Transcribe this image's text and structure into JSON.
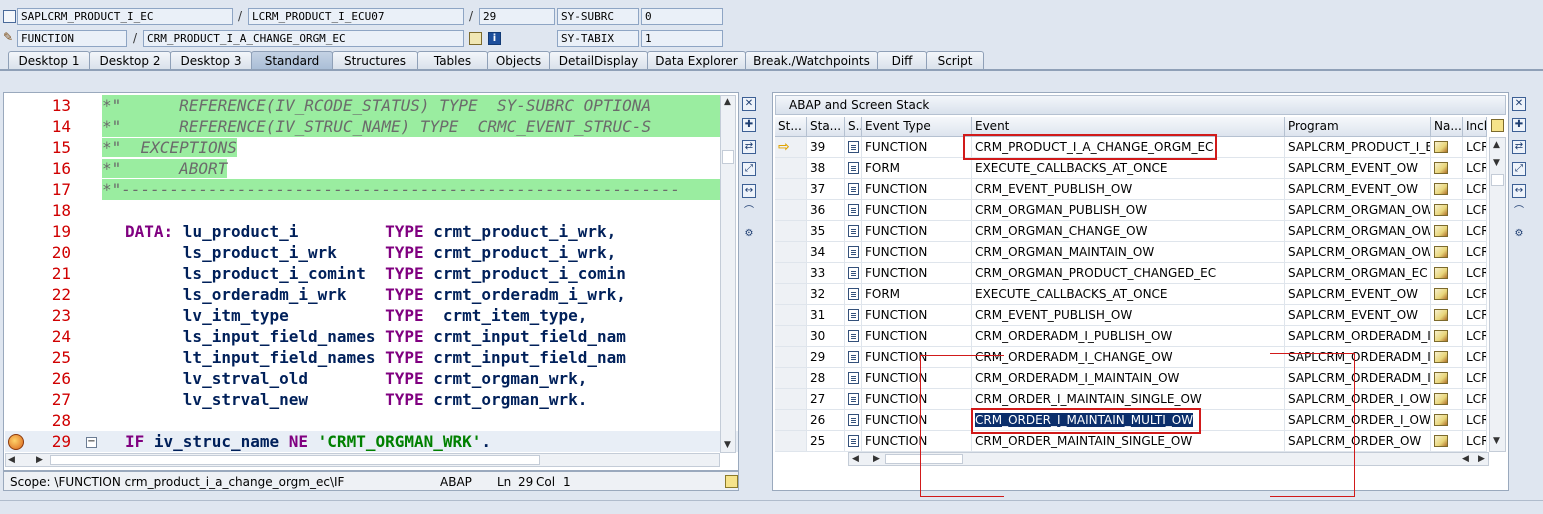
{
  "header": {
    "program": "SAPLCRM_PRODUCT_I_EC",
    "include": "LCRM_PRODUCT_I_ECU07",
    "line": "29",
    "subrc_label": "SY-SUBRC",
    "subrc_value": "0",
    "type": "FUNCTION",
    "name": "CRM_PRODUCT_I_A_CHANGE_ORGM_EC",
    "tabix_label": "SY-TABIX",
    "tabix_value": "1",
    "separator": "/"
  },
  "tabs": [
    "Desktop 1",
    "Desktop 2",
    "Desktop 3",
    "Standard",
    "Structures",
    "Tables",
    "Objects",
    "DetailDisplay",
    "Data Explorer",
    "Break./Watchpoints",
    "Diff",
    "Script"
  ],
  "active_tab": "Standard",
  "code": {
    "lines": [
      {
        "num": "13",
        "text": "*\"      REFERENCE(IV_RCODE_STATUS) TYPE  SY-SUBRC OPTIONA"
      },
      {
        "num": "14",
        "text": "*\"      REFERENCE(IV_STRUC_NAME) TYPE  CRMC_EVENT_STRUC-S"
      },
      {
        "num": "15",
        "text": "*\"  EXCEPTIONS"
      },
      {
        "num": "16",
        "text": "*\"      ABORT"
      },
      {
        "num": "17",
        "text": "*\"----------------------------------------------------------"
      },
      {
        "num": "18",
        "text": ""
      },
      {
        "num": "19",
        "kw": "DATA:",
        "id": " lu_product_i         ",
        "kw2": "TYPE",
        "id2": " crmt_product_i_wrk,"
      },
      {
        "num": "20",
        "kw": "",
        "id": "      ls_product_i_wrk     ",
        "kw2": "TYPE",
        "id2": " crmt_product_i_wrk,"
      },
      {
        "num": "21",
        "kw": "",
        "id": "      ls_product_i_comint  ",
        "kw2": "TYPE",
        "id2": " crmt_product_i_comin"
      },
      {
        "num": "22",
        "kw": "",
        "id": "      ls_orderadm_i_wrk    ",
        "kw2": "TYPE",
        "id2": " crmt_orderadm_i_wrk,"
      },
      {
        "num": "23",
        "kw": "",
        "id": "      lv_itm_type          ",
        "kw2": "TYPE",
        "id2": "  crmt_item_type,"
      },
      {
        "num": "24",
        "kw": "",
        "id": "      ls_input_field_names ",
        "kw2": "TYPE",
        "id2": " crmt_input_field_nam"
      },
      {
        "num": "25",
        "kw": "",
        "id": "      lt_input_field_names ",
        "kw2": "TYPE",
        "id2": " crmt_input_field_nam"
      },
      {
        "num": "26",
        "kw": "",
        "id": "      lv_strval_old        ",
        "kw2": "TYPE",
        "id2": " crmt_orgman_wrk,"
      },
      {
        "num": "27",
        "kw": "",
        "id": "      lv_strval_new        ",
        "kw2": "TYPE",
        "id2": " crmt_orgman_wrk."
      },
      {
        "num": "28",
        "text": ""
      },
      {
        "num": "29",
        "kw": "IF",
        "id": " iv_struc_name ",
        "kw2": "NE",
        "str": " 'CRMT_ORGMAN_WRK'",
        "tail": "."
      }
    ]
  },
  "status_bar": {
    "scope": "Scope: \\FUNCTION crm_product_i_a_change_orgm_ec\\IF",
    "lang": "ABAP",
    "ln_label": "Ln",
    "ln": "29",
    "col_label": "Col",
    "col": "1"
  },
  "stack": {
    "title": "ABAP and Screen Stack",
    "columns": [
      "St...",
      "Sta...",
      "S...",
      "Event Type",
      "Event",
      "Program",
      "Na...",
      "Incl"
    ],
    "rows": [
      {
        "level": "39",
        "type": "FUNCTION",
        "event": "CRM_PRODUCT_I_A_CHANGE_ORGM_EC",
        "program": "SAPLCRM_PRODUCT_I_EC",
        "incl": "LCR",
        "current": true
      },
      {
        "level": "38",
        "type": "FORM",
        "event": "EXECUTE_CALLBACKS_AT_ONCE",
        "program": "SAPLCRM_EVENT_OW",
        "incl": "LCR"
      },
      {
        "level": "37",
        "type": "FUNCTION",
        "event": "CRM_EVENT_PUBLISH_OW",
        "program": "SAPLCRM_EVENT_OW",
        "incl": "LCR"
      },
      {
        "level": "36",
        "type": "FUNCTION",
        "event": "CRM_ORGMAN_PUBLISH_OW",
        "program": "SAPLCRM_ORGMAN_OW",
        "incl": "LCR"
      },
      {
        "level": "35",
        "type": "FUNCTION",
        "event": "CRM_ORGMAN_CHANGE_OW",
        "program": "SAPLCRM_ORGMAN_OW",
        "incl": "LCR"
      },
      {
        "level": "34",
        "type": "FUNCTION",
        "event": "CRM_ORGMAN_MAINTAIN_OW",
        "program": "SAPLCRM_ORGMAN_OW",
        "incl": "LCR"
      },
      {
        "level": "33",
        "type": "FUNCTION",
        "event": "CRM_ORGMAN_PRODUCT_CHANGED_EC",
        "program": "SAPLCRM_ORGMAN_EC",
        "incl": "LCR"
      },
      {
        "level": "32",
        "type": "FORM",
        "event": "EXECUTE_CALLBACKS_AT_ONCE",
        "program": "SAPLCRM_EVENT_OW",
        "incl": "LCR"
      },
      {
        "level": "31",
        "type": "FUNCTION",
        "event": "CRM_EVENT_PUBLISH_OW",
        "program": "SAPLCRM_EVENT_OW",
        "incl": "LCR"
      },
      {
        "level": "30",
        "type": "FUNCTION",
        "event": "CRM_ORDERADM_I_PUBLISH_OW",
        "program": "SAPLCRM_ORDERADM_I...",
        "incl": "LCR"
      },
      {
        "level": "29",
        "type": "FUNCTION",
        "event": "CRM_ORDERADM_I_CHANGE_OW",
        "program": "SAPLCRM_ORDERADM_I...",
        "incl": "LCR"
      },
      {
        "level": "28",
        "type": "FUNCTION",
        "event": "CRM_ORDERADM_I_MAINTAIN_OW",
        "program": "SAPLCRM_ORDERADM_I...",
        "incl": "LCR"
      },
      {
        "level": "27",
        "type": "FUNCTION",
        "event": "CRM_ORDER_I_MAINTAIN_SINGLE_OW",
        "program": "SAPLCRM_ORDER_I_OW",
        "incl": "LCR"
      },
      {
        "level": "26",
        "type": "FUNCTION",
        "event": "CRM_ORDER_I_MAINTAIN_MULTI_OW",
        "program": "SAPLCRM_ORDER_I_OW",
        "incl": "LCR",
        "selected": true
      },
      {
        "level": "25",
        "type": "FUNCTION",
        "event": "CRM_ORDER_MAINTAIN_SINGLE_OW",
        "program": "SAPLCRM_ORDER_OW",
        "incl": "LCR"
      }
    ]
  },
  "colors": {
    "comment_bg": "#9aeda0",
    "keyword": "#800080",
    "line_number": "#d00000",
    "highlight": "#d11a1a",
    "selection": "#0b2e6b"
  }
}
